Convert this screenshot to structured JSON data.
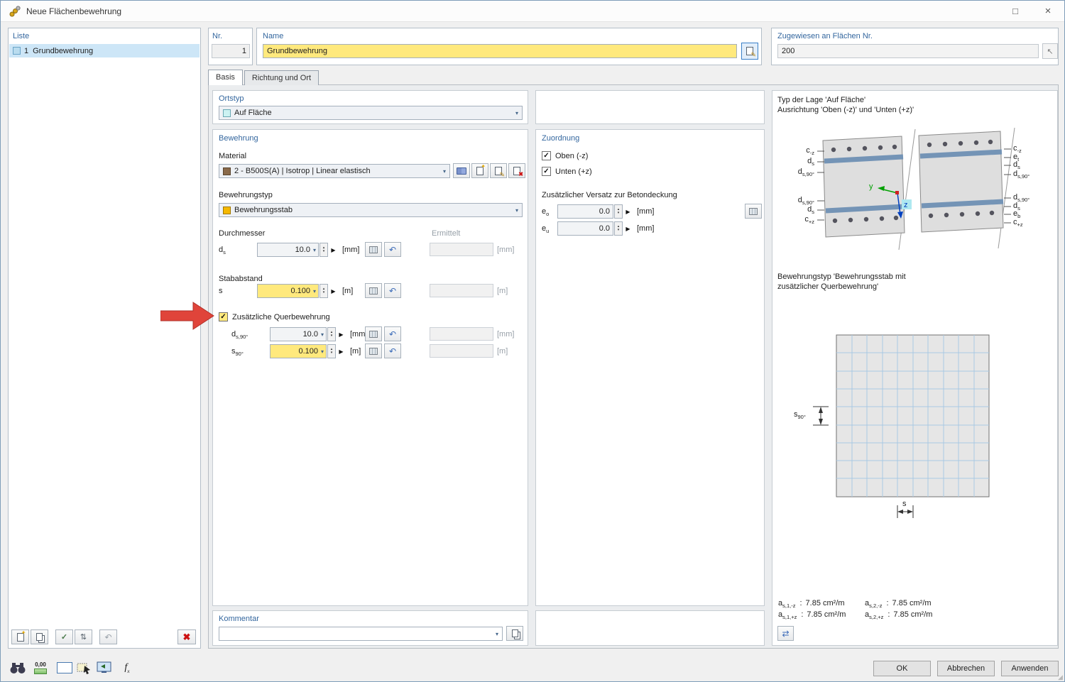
{
  "window": {
    "title": "Neue Flächenbewehrung"
  },
  "icons": {
    "maximize": "□",
    "close": "×",
    "chevron": "▾",
    "play": "▶",
    "spin_up": "▴",
    "spin_down": "▾",
    "undo": "↶",
    "check": "✓",
    "pencil": "✎",
    "pick": "↖",
    "delete": "✖",
    "star": "✦",
    "updown": "⇅",
    "grip": "◢",
    "swap": "⇄"
  },
  "liste": {
    "title": "Liste",
    "item_num": "1",
    "item_label": "Grundbewehrung"
  },
  "header": {
    "nr_label": "Nr.",
    "nr_value": "1",
    "name_label": "Name",
    "name_value": "Grundbewehrung",
    "assigned_label": "Zugewiesen an Flächen Nr.",
    "assigned_value": "200"
  },
  "tabs": {
    "basis": "Basis",
    "richtung": "Richtung und Ort"
  },
  "ortstyp": {
    "title": "Ortstyp",
    "value": "Auf Fläche"
  },
  "bewehrung": {
    "title": "Bewehrung",
    "material_label": "Material",
    "material_value": "2 - B500S(A) | Isotrop | Linear elastisch",
    "typ_label": "Bewehrungstyp",
    "typ_value": "Bewehrungsstab",
    "durchmesser_label": "Durchmesser",
    "ermittelt_label": "Ermittelt",
    "stababstand_label": "Stababstand",
    "quer_label": "Zusätzliche Querbewehrung",
    "ds": {
      "m": "d",
      "sub": "s",
      "value": "10.0",
      "unit": "[mm]",
      "erm_unit": "[mm]"
    },
    "s": {
      "m": "s",
      "sub": "",
      "value": "0.100",
      "unit": "[m]",
      "erm_unit": "[m]"
    },
    "ds90": {
      "m": "d",
      "sub": "s,90°",
      "value": "10.0",
      "unit": "[mm]",
      "erm_unit": "[mm]"
    },
    "s90": {
      "m": "s",
      "sub": "90°",
      "value": "0.100",
      "unit": "[m]",
      "erm_unit": "[m]"
    }
  },
  "zuordnung": {
    "title": "Zuordnung",
    "oben_label": "Oben (-z)",
    "unten_label": "Unten (+z)",
    "versatz_label": "Zusätzlicher Versatz zur Betondeckung",
    "eo": {
      "m": "e",
      "sub": "o",
      "value": "0.0",
      "unit": "[mm]"
    },
    "eu": {
      "m": "e",
      "sub": "u",
      "value": "0.0",
      "unit": "[mm]"
    }
  },
  "kommentar": {
    "title": "Kommentar"
  },
  "info": {
    "line1": "Typ der Lage 'Auf Fläche'",
    "line2": "Ausrichtung 'Oben (-z)' und 'Unten (+z)'",
    "line3": "Bewehrungstyp 'Bewehrungsstab mit",
    "line4": "zusätzlicher Querbewehrung'",
    "labels_left": [
      {
        "m": "c",
        "sub": "-z"
      },
      {
        "m": "d",
        "sub": "s"
      },
      {
        "m": "d",
        "sub": "s,90°"
      },
      {
        "m": "d",
        "sub": "s,90°"
      },
      {
        "m": "d",
        "sub": "s"
      },
      {
        "m": "c",
        "sub": "+z"
      }
    ],
    "labels_right": [
      {
        "m": "c",
        "sub": "-z"
      },
      {
        "m": "e",
        "sub": "t"
      },
      {
        "m": "d",
        "sub": "s"
      },
      {
        "m": "d",
        "sub": "s,90°"
      },
      {
        "m": "d",
        "sub": "s,90°"
      },
      {
        "m": "d",
        "sub": "s"
      },
      {
        "m": "e",
        "sub": "b"
      },
      {
        "m": "c",
        "sub": "+z"
      }
    ],
    "axis_y": "y",
    "axis_z": "z",
    "grid_s90_m": "s",
    "grid_s90_sub": "90°",
    "grid_s": "s",
    "colon": ":",
    "results": [
      {
        "m": "a",
        "sub": "s,1,-z",
        "value": "7.85 cm²/m"
      },
      {
        "m": "a",
        "sub": "s,2,-z",
        "value": "7.85 cm²/m"
      },
      {
        "m": "a",
        "sub": "s,1,+z",
        "value": "7.85 cm²/m"
      },
      {
        "m": "a",
        "sub": "s,2,+z",
        "value": "7.85 cm²/m"
      }
    ]
  },
  "footer": {
    "ok": "OK",
    "cancel": "Abbrechen",
    "apply": "Anwenden"
  },
  "statusbar": {
    "decimals": "0,00",
    "fx_m": "f",
    "fx_sub": "x"
  },
  "colors": {
    "accent_yellow": "#ffe97d",
    "selection_blue": "#cde6f7",
    "label_blue": "#33669e",
    "arrow_red": "#e0443a"
  }
}
